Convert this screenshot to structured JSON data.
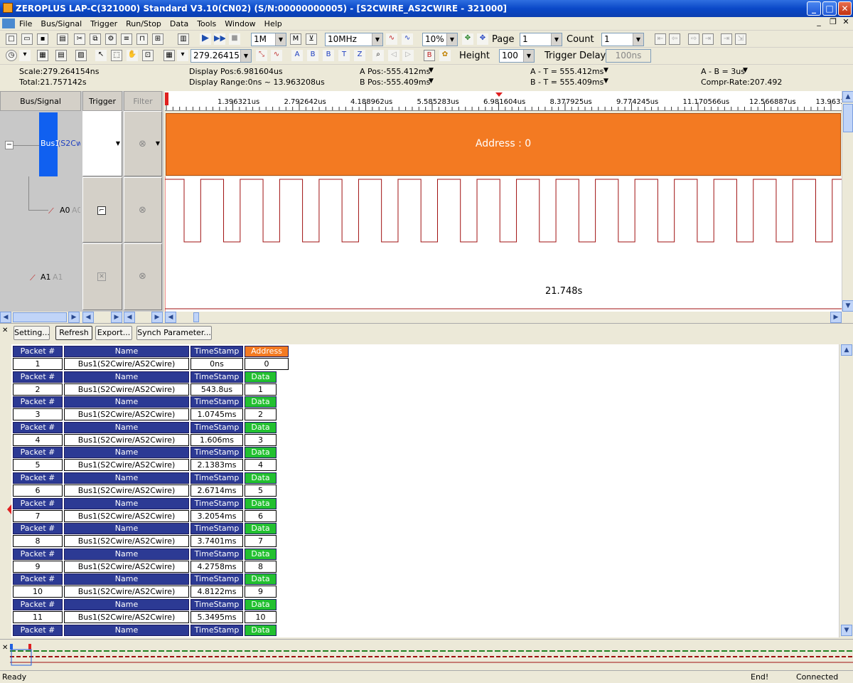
{
  "window": {
    "title": "ZEROPLUS LAP-C(321000) Standard V3.10(CN02) (S/N:00000000005) - [S2CWIRE_AS2CWIRE - 321000]",
    "minimize": "_",
    "maximize": "□",
    "close": "✕",
    "mdi_min": "_",
    "mdi_restore": "❐",
    "mdi_close": "✕"
  },
  "menu": {
    "items": [
      {
        "label": "File"
      },
      {
        "label": "Bus/Signal"
      },
      {
        "label": "Trigger"
      },
      {
        "label": "Run/Stop"
      },
      {
        "label": "Data"
      },
      {
        "label": "Tools"
      },
      {
        "label": "Window"
      },
      {
        "label": "Help"
      }
    ]
  },
  "toolbar1": {
    "memory": "1M",
    "freq": "10MHz",
    "trigger_pos": "10%",
    "page_label": "Page",
    "page_value": "1",
    "count_label": "Count",
    "count_value": "1"
  },
  "toolbar2": {
    "scale_value": "279.26415",
    "height_label": "Height",
    "height_value": "100",
    "trigger_delay_label": "Trigger Delay",
    "trigger_delay_value": "100ns"
  },
  "info": {
    "scale": "Scale:279.264154ns",
    "total": "Total:21.757142s",
    "display_pos": "Display Pos:6.981604us",
    "display_range": "Display Range:0ns ~ 13.963208us",
    "a_pos": "A Pos:-555.412ms",
    "b_pos": "B Pos:-555.409ms",
    "a_t": "A - T = 555.412ms",
    "b_t": "B - T = 555.409ms",
    "a_b": "A - B = 3us",
    "compr_rate": "Compr-Rate:207.492"
  },
  "columns": {
    "bus_signal": "Bus/Signal",
    "trigger": "Trigger",
    "filter": "Filter"
  },
  "signals": {
    "bus1_name": "Bus1",
    "bus1_proto": "(S2Cw",
    "a0_name": "A0",
    "a0_alias": "A0",
    "a1_name": "A1",
    "a1_alias": "A1"
  },
  "timeline": {
    "ticks": [
      "1.396321us",
      "2.792642us",
      "4.188962us",
      "5.585283us",
      "6.981604us",
      "8.377925us",
      "9.774245us",
      "11.170566us",
      "12.566887us",
      "13.9632"
    ]
  },
  "waveform": {
    "bus_label": "Address : 0",
    "a1_time": "21.748s",
    "a0_pulses_visible": 17
  },
  "buttons": {
    "setting": "Setting...",
    "refresh": "Refresh",
    "export": "Export...",
    "synch": "Synch Parameter..."
  },
  "packet_headers": {
    "packet": "Packet #",
    "name": "Name",
    "timestamp": "TimeStamp",
    "address": "Address",
    "data": "Data"
  },
  "packets": [
    {
      "num": "1",
      "name": "Bus1(S2Cwire/AS2Cwire)",
      "ts": "0ns",
      "kind": "Address",
      "val": "0"
    },
    {
      "num": "2",
      "name": "Bus1(S2Cwire/AS2Cwire)",
      "ts": "543.8us",
      "kind": "Data",
      "val": "1"
    },
    {
      "num": "3",
      "name": "Bus1(S2Cwire/AS2Cwire)",
      "ts": "1.0745ms",
      "kind": "Data",
      "val": "2"
    },
    {
      "num": "4",
      "name": "Bus1(S2Cwire/AS2Cwire)",
      "ts": "1.606ms",
      "kind": "Data",
      "val": "3"
    },
    {
      "num": "5",
      "name": "Bus1(S2Cwire/AS2Cwire)",
      "ts": "2.1383ms",
      "kind": "Data",
      "val": "4"
    },
    {
      "num": "6",
      "name": "Bus1(S2Cwire/AS2Cwire)",
      "ts": "2.6714ms",
      "kind": "Data",
      "val": "5"
    },
    {
      "num": "7",
      "name": "Bus1(S2Cwire/AS2Cwire)",
      "ts": "3.2054ms",
      "kind": "Data",
      "val": "6"
    },
    {
      "num": "8",
      "name": "Bus1(S2Cwire/AS2Cwire)",
      "ts": "3.7401ms",
      "kind": "Data",
      "val": "7"
    },
    {
      "num": "9",
      "name": "Bus1(S2Cwire/AS2Cwire)",
      "ts": "4.2758ms",
      "kind": "Data",
      "val": "8"
    },
    {
      "num": "10",
      "name": "Bus1(S2Cwire/AS2Cwire)",
      "ts": "4.8122ms",
      "kind": "Data",
      "val": "9"
    },
    {
      "num": "11",
      "name": "Bus1(S2Cwire/AS2Cwire)",
      "ts": "5.3495ms",
      "kind": "Data",
      "val": "10"
    }
  ],
  "status": {
    "ready": "Ready",
    "end": "End!",
    "connected": "Connected"
  },
  "colors": {
    "title_blue": "#0a48c8",
    "bus_orange": "#f37a22",
    "wave_red": "#a01010",
    "packet_header": "#2c3a94",
    "data_green": "#22c030"
  }
}
